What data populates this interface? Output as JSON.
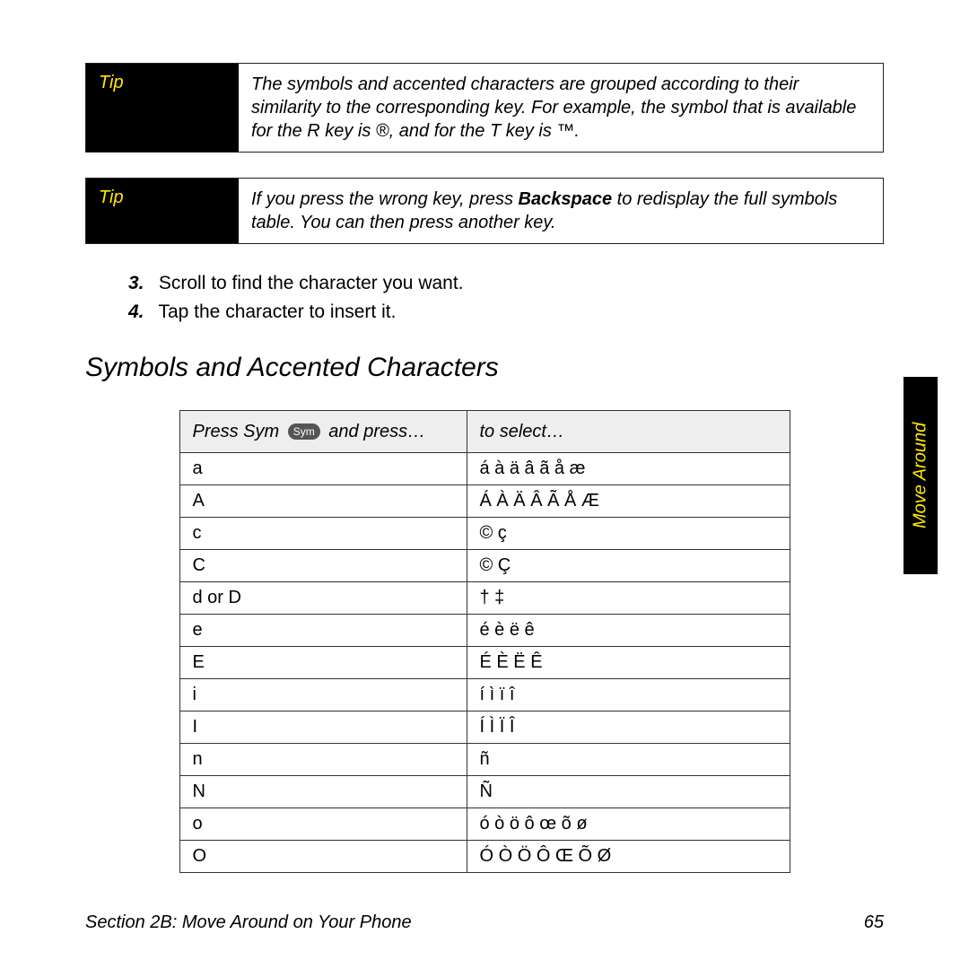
{
  "tips": [
    {
      "label": "Tip",
      "body": "The symbols and accented characters are grouped according to their similarity to the corresponding key. For example, the symbol that is available for the R key is ®, and for the T key is ™."
    },
    {
      "label": "Tip",
      "body_pre": "If you press the wrong key, press ",
      "body_bold": "Backspace",
      "body_post": " to redisplay the full symbols table. You can then press another key."
    }
  ],
  "steps": [
    {
      "num": "3.",
      "text": "Scroll to find the character you want."
    },
    {
      "num": "4.",
      "text": "Tap the character to insert it."
    }
  ],
  "section_title": "Symbols and Accented Characters",
  "table": {
    "header_left_pre": "Press Sym ",
    "header_left_pill": "Sym",
    "header_left_post": " and press…",
    "header_right": "to select…",
    "rows": [
      {
        "press": "a",
        "select": "á à ä â ã å æ"
      },
      {
        "press": "A",
        "select": "Á À Ä Â Ã Å Æ"
      },
      {
        "press": "c",
        "select": "© ç"
      },
      {
        "press": "C",
        "select": "© Ç"
      },
      {
        "press": "d or D",
        "select": "† ‡"
      },
      {
        "press": "e",
        "select": "é è ë ê"
      },
      {
        "press": "E",
        "select": "É È Ë Ê"
      },
      {
        "press": "i",
        "select": "í ì ï î"
      },
      {
        "press": "I",
        "select": "Í Ì Ï Î"
      },
      {
        "press": "n",
        "select": "ñ"
      },
      {
        "press": "N",
        "select": "Ñ"
      },
      {
        "press": "o",
        "select": "ó ò ö ô œ õ ø"
      },
      {
        "press": "O",
        "select": "Ó Ò Ö Ô Œ Õ Ø"
      }
    ]
  },
  "side_tab": "Move Around",
  "footer_left": "Section 2B: Move Around on Your Phone",
  "footer_right": "65"
}
